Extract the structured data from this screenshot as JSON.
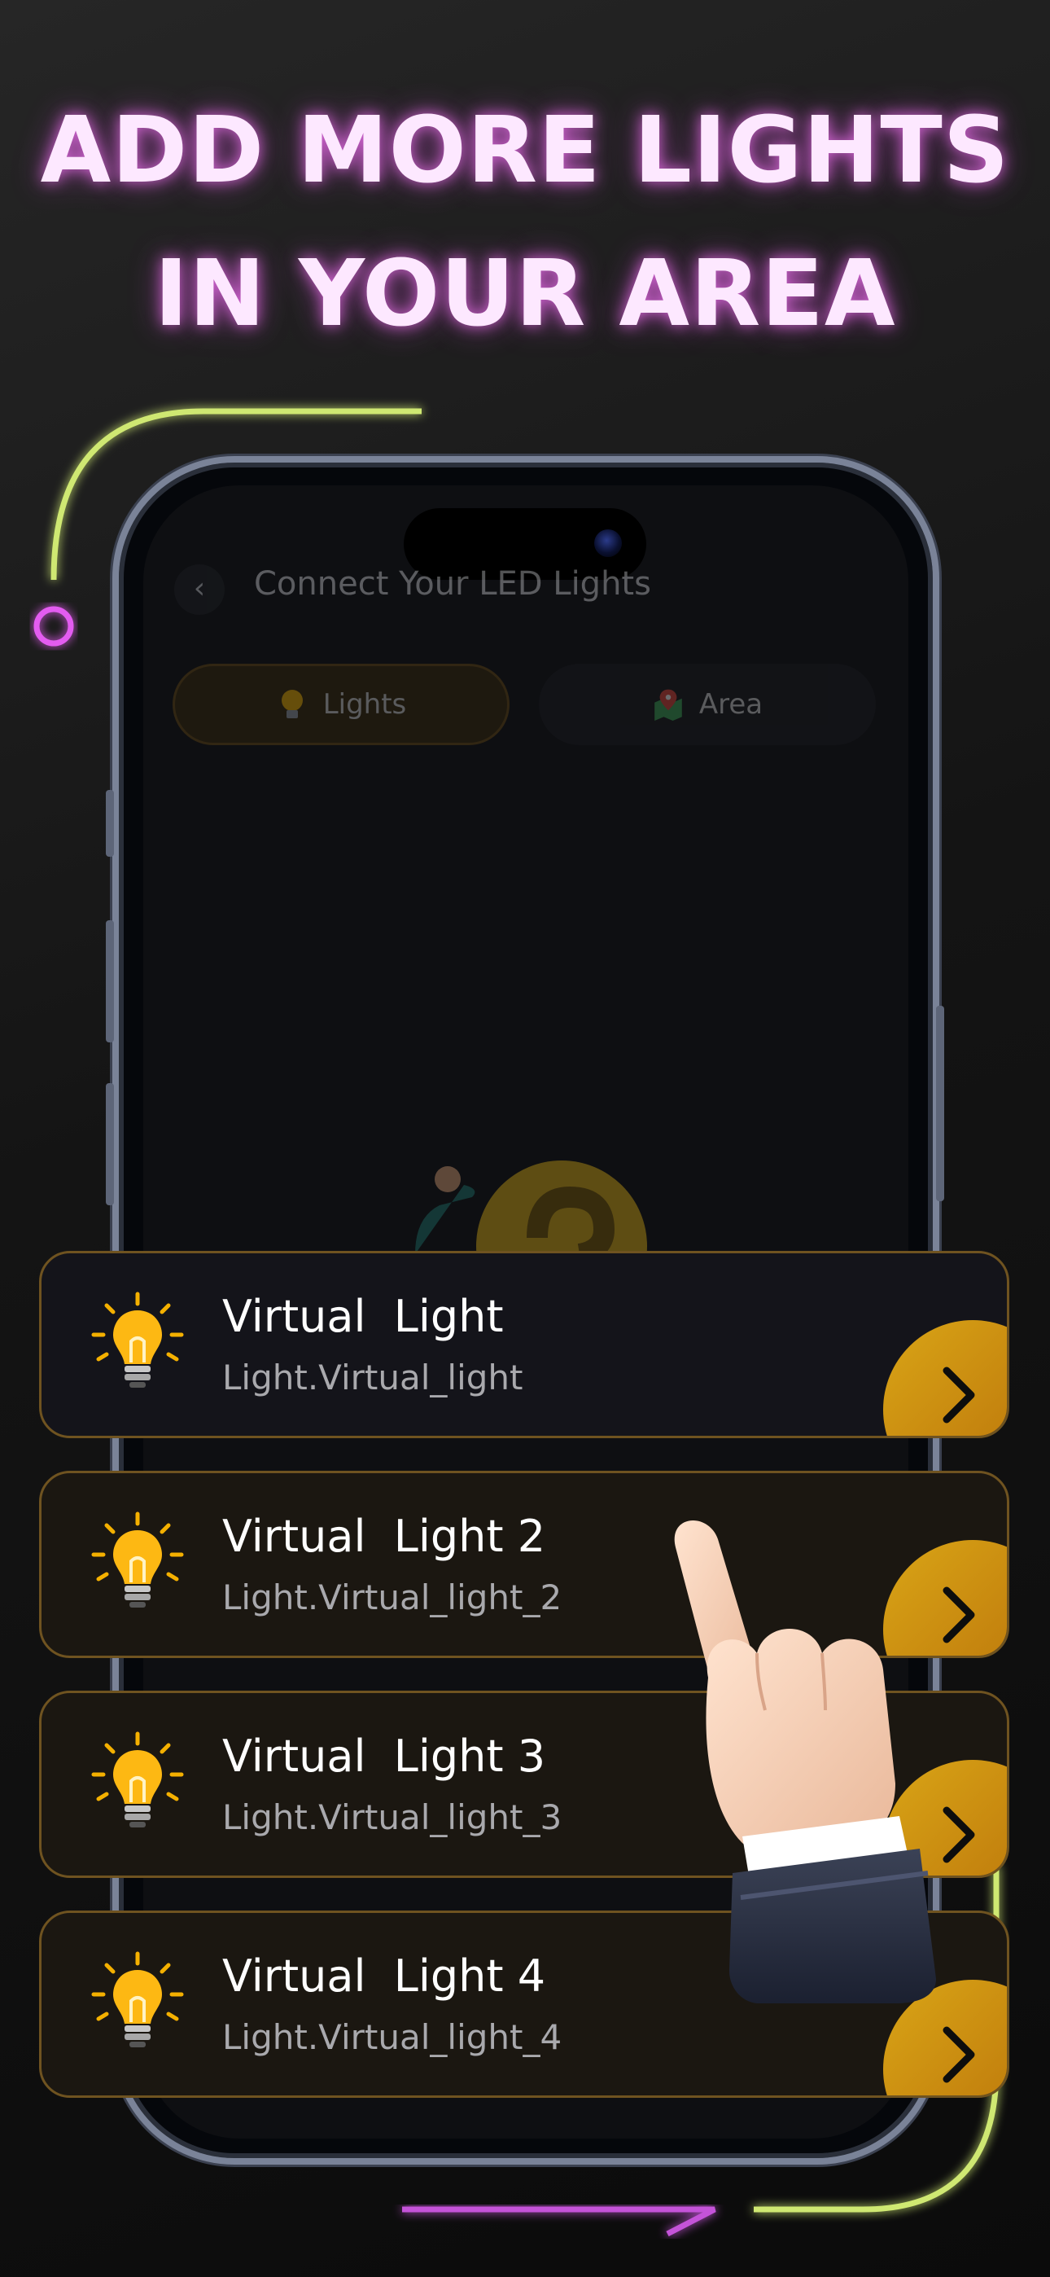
{
  "headline": {
    "line1": "ADD MORE LIGHTS",
    "line2": "IN YOUR AREA"
  },
  "colors": {
    "neon_pink": "#e35cf0",
    "neon_green": "#cfe872",
    "accent_gold": "#d4a017",
    "card_border": "#6f5320"
  },
  "screen": {
    "back_icon": "chevron-left-icon",
    "title": "Connect Your LED Lights",
    "tabs": [
      {
        "label": "Lights",
        "icon": "lightbulb-icon",
        "selected": true
      },
      {
        "label": "Area",
        "icon": "map-pin-icon",
        "selected": false
      }
    ]
  },
  "cards": [
    {
      "title": "Virtual  Light",
      "subtitle": "Light.Virtual_light",
      "icon": "lightbulb-icon",
      "action_icon": "chevron-right-icon"
    },
    {
      "title": "Virtual  Light 2",
      "subtitle": "Light.Virtual_light_2",
      "icon": "lightbulb-icon",
      "action_icon": "chevron-right-icon"
    },
    {
      "title": "Virtual  Light 3",
      "subtitle": "Light.Virtual_light_3",
      "icon": "lightbulb-icon",
      "action_icon": "chevron-right-icon"
    },
    {
      "title": "Virtual  Light 4",
      "subtitle": "Light.Virtual_light_4",
      "icon": "lightbulb-icon",
      "action_icon": "chevron-right-icon"
    }
  ]
}
